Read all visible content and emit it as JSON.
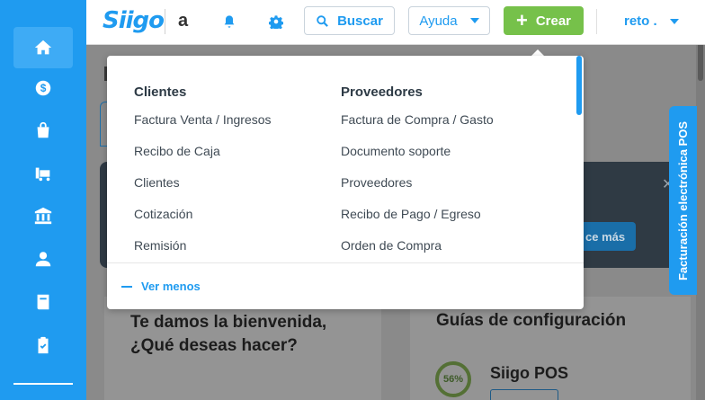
{
  "header": {
    "logo": "Siigo",
    "company": "a",
    "search_label": "Buscar",
    "help_label": "Ayuda",
    "create_label": "Crear",
    "user_label": "reto ."
  },
  "sidebar": {
    "items": [
      {
        "icon": "home-icon",
        "active": true
      },
      {
        "icon": "dollar-icon"
      },
      {
        "icon": "shopping-bag-icon"
      },
      {
        "icon": "truck-icon"
      },
      {
        "icon": "bank-icon"
      },
      {
        "icon": "user-icon"
      },
      {
        "icon": "book-icon"
      },
      {
        "icon": "clipboard-check-icon"
      }
    ]
  },
  "dropdown": {
    "col1_title": "Clientes",
    "col1_items": [
      "Factura Venta / Ingresos",
      "Recibo de Caja",
      "Clientes",
      "Cotización",
      "Remisión"
    ],
    "col2_title": "Proveedores",
    "col2_items": [
      "Factura de Compra / Gasto",
      "Documento soporte",
      "Proveedores",
      "Recibo de Pago / Egreso",
      "Orden de Compra"
    ],
    "toggle_label": "Ver menos"
  },
  "background": {
    "banner_button": "ce más",
    "welcome_line1": "Te damos la bienvenida,",
    "welcome_line2": "¿Qué deseas hacer?",
    "guides_title": "Guías de configuración",
    "guide_progress": "56%",
    "guide_name": "Siigo POS"
  },
  "pos_tab_label": "Facturación electrónica POS",
  "colors": {
    "primary": "#1f9bf0",
    "create": "#76c14a"
  }
}
